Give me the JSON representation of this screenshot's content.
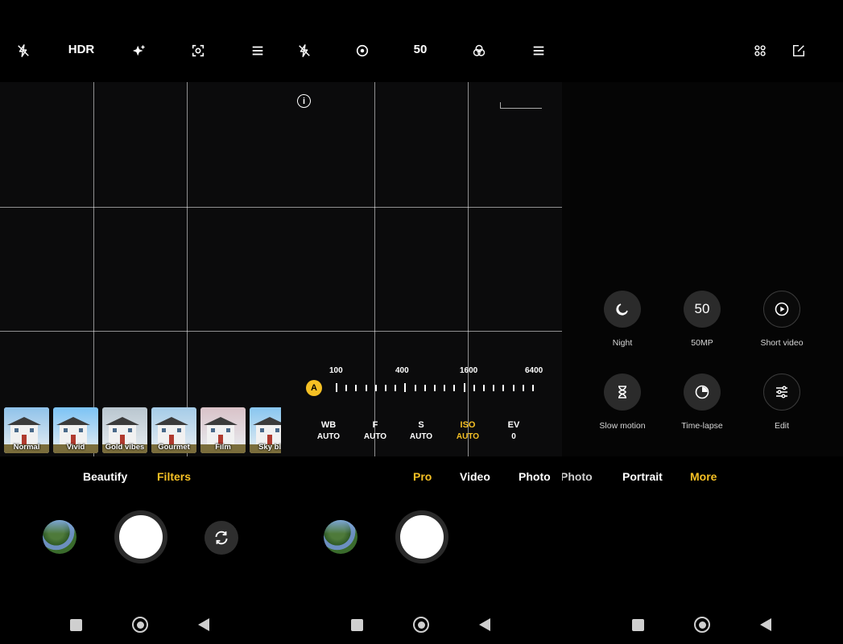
{
  "panel_filters": {
    "top_bar": {
      "hdr_label": "HDR"
    },
    "filter_thumbs": [
      {
        "label": "Normal",
        "sky": "#8fc2ea",
        "selected": true
      },
      {
        "label": "Vivid",
        "sky": "#7cc3f5",
        "selected": false
      },
      {
        "label": "Gold vibes",
        "sky": "#b9c6cf",
        "selected": false
      },
      {
        "label": "Gourmet",
        "sky": "#a5cce8",
        "selected": false
      },
      {
        "label": "Film",
        "sky": "#d9c2c8",
        "selected": false
      },
      {
        "label": "Sky blu",
        "sky": "#88c6f0",
        "selected": false
      }
    ],
    "tabs": {
      "beautify": "Beautify",
      "filters": "Filters"
    }
  },
  "panel_pro": {
    "top_bar": {
      "resolution_label": "50"
    },
    "iso_scale": {
      "labels": [
        "100",
        "400",
        "1600",
        "6400"
      ],
      "auto_badge": "A"
    },
    "info_icon": "i",
    "params": [
      {
        "name": "WB",
        "value": "AUTO",
        "active": false
      },
      {
        "name": "F",
        "value": "AUTO",
        "active": false
      },
      {
        "name": "S",
        "value": "AUTO",
        "active": false
      },
      {
        "name": "ISO",
        "value": "AUTO",
        "active": true
      },
      {
        "name": "EV",
        "value": "0",
        "active": false
      }
    ],
    "modes": {
      "pro": "Pro",
      "video": "Video",
      "photo": "Photo"
    }
  },
  "panel_more": {
    "tiles": [
      {
        "label": "Night",
        "icon": "moon-icon"
      },
      {
        "label": "50MP",
        "icon": "text",
        "number": "50"
      },
      {
        "label": "Short video",
        "icon": "play-icon"
      },
      {
        "label": "Slow motion",
        "icon": "hourglass-icon"
      },
      {
        "label": "Time-lapse",
        "icon": "timer-icon"
      },
      {
        "label": "Edit",
        "icon": "sliders-icon"
      }
    ],
    "modes": {
      "photo": "Photo",
      "portrait": "Portrait",
      "more": "More"
    }
  },
  "colors": {
    "accent": "#f5c024",
    "background": "#000000"
  }
}
